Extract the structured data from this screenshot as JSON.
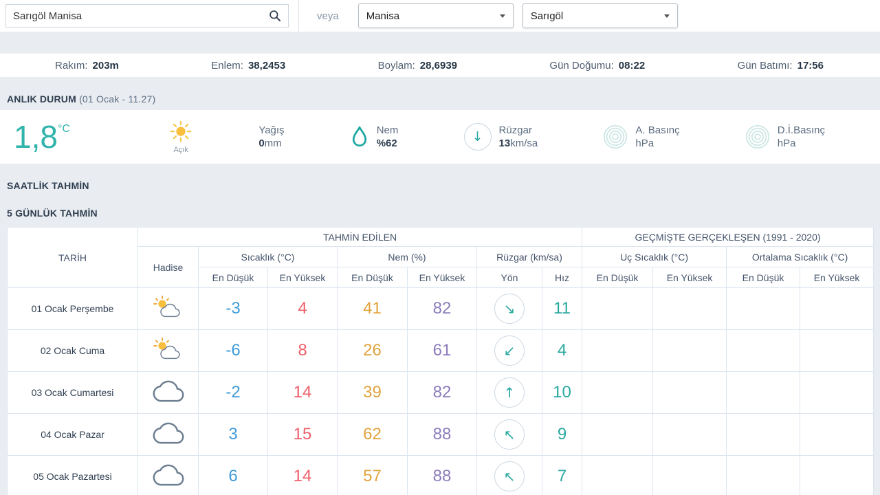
{
  "search": {
    "input_value": "Sarıgöl Manisa",
    "or_label": "veya",
    "province": "Manisa",
    "district": "Sarıgöl"
  },
  "info_bar": [
    {
      "label": "Rakım:",
      "value": "203m"
    },
    {
      "label": "Enlem:",
      "value": "38,2453"
    },
    {
      "label": "Boylam:",
      "value": "28,6939"
    },
    {
      "label": "Gün Doğumu:",
      "value": "08:22"
    },
    {
      "label": "Gün Batımı:",
      "value": "17:56"
    }
  ],
  "current": {
    "title": "ANLIK DURUM",
    "subtitle": "(01 Ocak - 11.27)",
    "temperature": "1,8",
    "temperature_unit": "°C",
    "condition": "Açık",
    "condition_icon": "sun",
    "precip_label": "Yağış",
    "precip_value": "0",
    "precip_unit": "mm",
    "humidity_label": "Nem",
    "humidity_value": "%62",
    "humidity_icon": "water-drop",
    "wind_label": "Rüzgar",
    "wind_value": "13",
    "wind_unit": "km/sa",
    "wind_arrow": "↓",
    "wind_icon": "wind-direction-circle",
    "pressure_label": "A. Basınç",
    "pressure_unit": "hPa",
    "pressure_icon": "concentric-rings",
    "sea_pressure_label": "D.İ.Basınç",
    "sea_pressure_unit": "hPa",
    "sea_pressure_icon": "concentric-rings"
  },
  "hourly_title": "SAATLİK TAHMİN",
  "daily": {
    "title": "5 GÜNLÜK TAHMİN",
    "header": {
      "date": "TARİH",
      "predicted": "TAHMİN EDİLEN",
      "historical": "GEÇMİŞTE GERÇEKLEŞEN (1991 - 2020)",
      "condition": "Hadise",
      "temp": "Sıcaklık (°C)",
      "humidity": "Nem (%)",
      "wind": "Rüzgar (km/sa)",
      "extreme_temp": "Uç Sıcaklık (°C)",
      "avg_temp": "Ortalama Sıcaklık (°C)",
      "low": "En Düşük",
      "high": "En Yüksek",
      "dir": "Yön",
      "speed": "Hız"
    },
    "rows": [
      {
        "date": "01 Ocak Perşembe",
        "icon": "partly-cloudy",
        "temp_low": "-3",
        "temp_high": "4",
        "hum_low": "41",
        "hum_high": "82",
        "wind_arrow": "↘",
        "wind_speed": "11"
      },
      {
        "date": "02 Ocak Cuma",
        "icon": "partly-cloudy",
        "temp_low": "-6",
        "temp_high": "8",
        "hum_low": "26",
        "hum_high": "61",
        "wind_arrow": "↙",
        "wind_speed": "4"
      },
      {
        "date": "03 Ocak Cumartesi",
        "icon": "cloudy",
        "temp_low": "-2",
        "temp_high": "14",
        "hum_low": "39",
        "hum_high": "82",
        "wind_arrow": "↑",
        "wind_speed": "10"
      },
      {
        "date": "04 Ocak Pazar",
        "icon": "cloudy",
        "temp_low": "3",
        "temp_high": "15",
        "hum_low": "62",
        "hum_high": "88",
        "wind_arrow": "↖",
        "wind_speed": "9"
      },
      {
        "date": "05 Ocak Pazartesi",
        "icon": "cloudy",
        "temp_low": "6",
        "temp_high": "14",
        "hum_low": "57",
        "hum_high": "88",
        "wind_arrow": "↖",
        "wind_speed": "7"
      }
    ]
  },
  "colors": {
    "accent_teal": "#2fb3aa",
    "low_blue": "#3f9bd8",
    "high_red": "#ee5f6b",
    "humidity_low_orange": "#e2a33c",
    "humidity_high_purple": "#8d7cba",
    "navy_text": "#2f3e50"
  }
}
